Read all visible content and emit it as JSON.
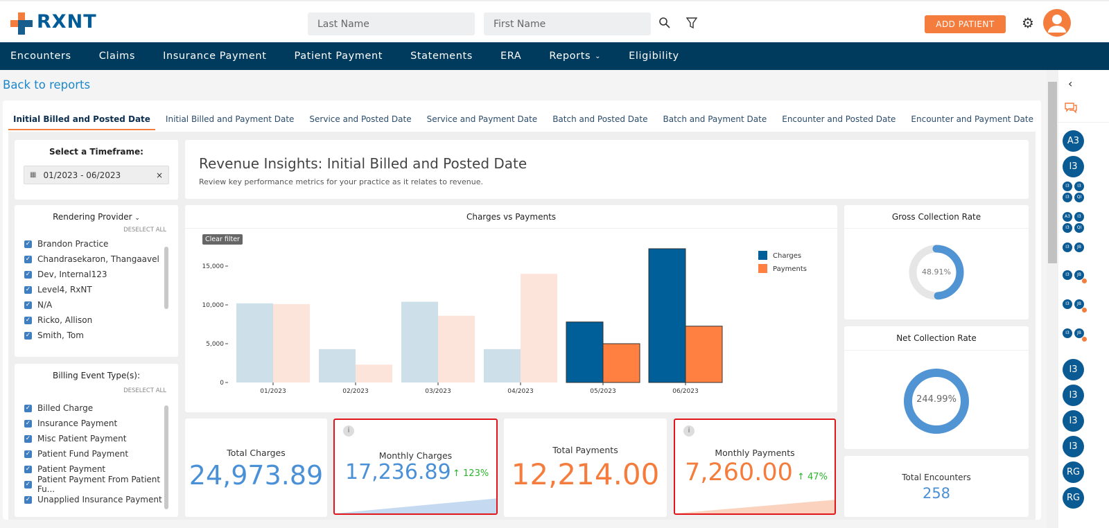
{
  "header": {
    "brand": "RXNT",
    "last_name_placeholder": "Last Name",
    "first_name_placeholder": "First Name",
    "add_patient": "ADD PATIENT"
  },
  "nav": [
    "Encounters",
    "Claims",
    "Insurance Payment",
    "Patient Payment",
    "Statements",
    "ERA",
    "Reports",
    "Eligibility"
  ],
  "back": "Back to reports",
  "tabs": [
    "Initial Billed and Posted Date",
    "Initial Billed and Payment Date",
    "Service and Posted Date",
    "Service and Payment Date",
    "Batch and Posted Date",
    "Batch and Payment Date",
    "Encounter and Posted Date",
    "Encounter and Payment Date"
  ],
  "timeframe": {
    "label": "Select a Timeframe:",
    "value": "01/2023 - 06/2023"
  },
  "provider": {
    "label": "Rendering Provider",
    "deselect": "DESELECT ALL",
    "items": [
      "Brandon Practice",
      "Chandrasekaron, Thangaavel",
      "Dev, Internal123",
      "Level4, RxNT",
      "N/A",
      "Ricko, Allison",
      "Smith, Tom"
    ]
  },
  "billing": {
    "label": "Billing Event Type(s):",
    "deselect": "DESELECT ALL",
    "items": [
      "Billed Charge",
      "Insurance Payment",
      "Misc Patient Payment",
      "Patient Fund Payment",
      "Patient Payment",
      "Patient Payment From Patient Fu...",
      "Unapplied Insurance Payment"
    ]
  },
  "insights": {
    "title": "Revenue Insights: Initial Billed and Posted Date",
    "subtitle": "Review key performance metrics for your practice as it relates to revenue."
  },
  "clear_filter": "Clear filter",
  "chart_data": {
    "type": "bar",
    "title": "Charges vs Payments",
    "categories": [
      "01/2023",
      "02/2023",
      "03/2023",
      "04/2023",
      "05/2023",
      "06/2023"
    ],
    "series": [
      {
        "name": "Charges",
        "values": [
          10200,
          4300,
          10400,
          4300,
          7800,
          17237
        ],
        "color": "#005f99",
        "faded_color": "#cde0ea"
      },
      {
        "name": "Payments",
        "values": [
          10100,
          2300,
          8600,
          14000,
          5000,
          7260
        ],
        "color": "#ff8040",
        "faded_color": "#fde4da"
      }
    ],
    "selected": [
      "05/2023",
      "06/2023"
    ],
    "yticks": [
      "0",
      "5,000",
      "10,000",
      "15,000"
    ],
    "ytick_values": [
      0,
      5000,
      10000,
      15000
    ],
    "ylim": [
      0,
      17500
    ],
    "legend": "top-right"
  },
  "gross": {
    "title": "Gross Collection Rate",
    "value": "48.91%",
    "pct": 48.91
  },
  "net": {
    "title": "Net Collection Rate",
    "value": "244.99%",
    "pct": 244.99
  },
  "encounters": {
    "title": "Total Encounters",
    "value": "258"
  },
  "kpis": {
    "total_charges": {
      "title": "Total Charges",
      "value": "24,973.89"
    },
    "monthly_charges": {
      "title": "Monthly Charges",
      "value": "17,236.89",
      "change": "123%"
    },
    "total_payments": {
      "title": "Total Payments",
      "value": "12,214.00"
    },
    "monthly_payments": {
      "title": "Monthly Payments",
      "value": "7,260.00",
      "change": "47%"
    }
  },
  "sidebar": {
    "avatars": [
      "A3",
      "I3"
    ],
    "groups": [
      [
        "I3",
        "I3",
        "I3",
        "QI"
      ],
      [
        "A3",
        "I3",
        "I3",
        "QI"
      ],
      [
        "I3",
        "JB"
      ],
      [
        "I3",
        "JB"
      ],
      [
        "I3",
        "JB"
      ],
      [
        "I3",
        "JB"
      ]
    ],
    "avatars2": [
      "I3",
      "I3",
      "I3",
      "I3",
      "RG",
      "RG"
    ]
  }
}
